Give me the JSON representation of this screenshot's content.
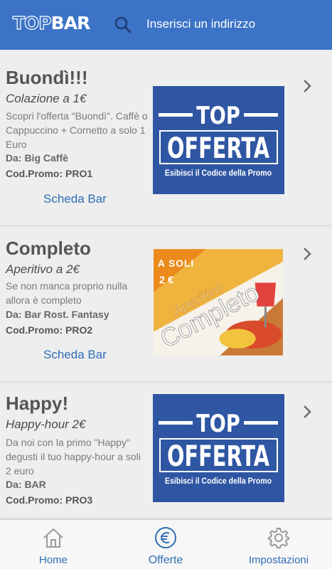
{
  "header": {
    "logo_top": "TOP",
    "logo_bar": "BAR",
    "search_placeholder": "Inserisci un indirizzo",
    "color": "#3c73c6"
  },
  "offers": [
    {
      "title": "Buondì!!!",
      "subtitle": "Colazione a 1€",
      "description": "Scopri l'offerta \"Buondì\". Caffè o Cappuccino + Cornetto a solo 1 Euro",
      "from": "Da: Big Caffè",
      "promo": "Cod.Promo: PRO1",
      "link": "Scheda Bar",
      "image": {
        "type": "top-offerta",
        "line1": "TOP",
        "line2": "OFFERTA",
        "line3": "Esibisci il Codice della Promo"
      }
    },
    {
      "title": "Completo",
      "subtitle": "Aperitivo a 2€",
      "description": "Se non manca proprio nulla allora è completo",
      "from": "Da: Bar Rost. Fantasy",
      "promo": "Cod.Promo: PRO2",
      "link": "Scheda Bar",
      "image": {
        "type": "aperitivo",
        "badge1": "A SOLI",
        "badge2": "2 €",
        "word1": "Aperitivo",
        "word2": "Completo"
      }
    },
    {
      "title": "Happy!",
      "subtitle": "Happy-hour 2€",
      "description": "Da noi con la primo \"Happy\" degusti il tuo happy-hour a soli 2 euro",
      "from": "Da: BAR",
      "promo": "Cod.Promo: PRO3",
      "link": "",
      "image": {
        "type": "top-offerta",
        "line1": "TOP",
        "line2": "OFFERTA",
        "line3": "Esibisci il Codice della Promo"
      }
    }
  ],
  "tabbar": {
    "items": [
      {
        "label": "Home",
        "icon": "home-icon",
        "active": false
      },
      {
        "label": "Offerte",
        "icon": "euro-icon",
        "active": true
      },
      {
        "label": "Impostazioni",
        "icon": "gear-icon",
        "active": false
      }
    ],
    "active_color": "#2f6db5",
    "inactive_color": "#9a9a9a"
  }
}
